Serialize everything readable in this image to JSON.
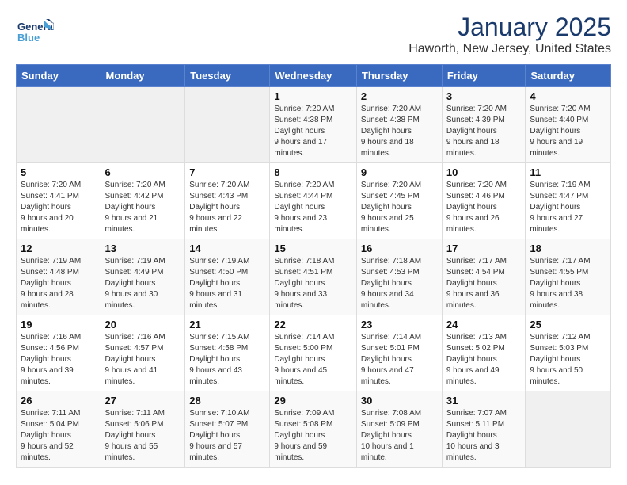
{
  "header": {
    "logo_line1": "General",
    "logo_line2": "Blue",
    "month": "January 2025",
    "location": "Haworth, New Jersey, United States"
  },
  "days_of_week": [
    "Sunday",
    "Monday",
    "Tuesday",
    "Wednesday",
    "Thursday",
    "Friday",
    "Saturday"
  ],
  "weeks": [
    [
      {
        "day": "",
        "empty": true
      },
      {
        "day": "",
        "empty": true
      },
      {
        "day": "",
        "empty": true
      },
      {
        "day": "1",
        "sunrise": "7:20 AM",
        "sunset": "4:38 PM",
        "daylight": "9 hours and 17 minutes."
      },
      {
        "day": "2",
        "sunrise": "7:20 AM",
        "sunset": "4:38 PM",
        "daylight": "9 hours and 18 minutes."
      },
      {
        "day": "3",
        "sunrise": "7:20 AM",
        "sunset": "4:39 PM",
        "daylight": "9 hours and 18 minutes."
      },
      {
        "day": "4",
        "sunrise": "7:20 AM",
        "sunset": "4:40 PM",
        "daylight": "9 hours and 19 minutes."
      }
    ],
    [
      {
        "day": "5",
        "sunrise": "7:20 AM",
        "sunset": "4:41 PM",
        "daylight": "9 hours and 20 minutes."
      },
      {
        "day": "6",
        "sunrise": "7:20 AM",
        "sunset": "4:42 PM",
        "daylight": "9 hours and 21 minutes."
      },
      {
        "day": "7",
        "sunrise": "7:20 AM",
        "sunset": "4:43 PM",
        "daylight": "9 hours and 22 minutes."
      },
      {
        "day": "8",
        "sunrise": "7:20 AM",
        "sunset": "4:44 PM",
        "daylight": "9 hours and 23 minutes."
      },
      {
        "day": "9",
        "sunrise": "7:20 AM",
        "sunset": "4:45 PM",
        "daylight": "9 hours and 25 minutes."
      },
      {
        "day": "10",
        "sunrise": "7:20 AM",
        "sunset": "4:46 PM",
        "daylight": "9 hours and 26 minutes."
      },
      {
        "day": "11",
        "sunrise": "7:19 AM",
        "sunset": "4:47 PM",
        "daylight": "9 hours and 27 minutes."
      }
    ],
    [
      {
        "day": "12",
        "sunrise": "7:19 AM",
        "sunset": "4:48 PM",
        "daylight": "9 hours and 28 minutes."
      },
      {
        "day": "13",
        "sunrise": "7:19 AM",
        "sunset": "4:49 PM",
        "daylight": "9 hours and 30 minutes."
      },
      {
        "day": "14",
        "sunrise": "7:19 AM",
        "sunset": "4:50 PM",
        "daylight": "9 hours and 31 minutes."
      },
      {
        "day": "15",
        "sunrise": "7:18 AM",
        "sunset": "4:51 PM",
        "daylight": "9 hours and 33 minutes."
      },
      {
        "day": "16",
        "sunrise": "7:18 AM",
        "sunset": "4:53 PM",
        "daylight": "9 hours and 34 minutes."
      },
      {
        "day": "17",
        "sunrise": "7:17 AM",
        "sunset": "4:54 PM",
        "daylight": "9 hours and 36 minutes."
      },
      {
        "day": "18",
        "sunrise": "7:17 AM",
        "sunset": "4:55 PM",
        "daylight": "9 hours and 38 minutes."
      }
    ],
    [
      {
        "day": "19",
        "sunrise": "7:16 AM",
        "sunset": "4:56 PM",
        "daylight": "9 hours and 39 minutes."
      },
      {
        "day": "20",
        "sunrise": "7:16 AM",
        "sunset": "4:57 PM",
        "daylight": "9 hours and 41 minutes."
      },
      {
        "day": "21",
        "sunrise": "7:15 AM",
        "sunset": "4:58 PM",
        "daylight": "9 hours and 43 minutes."
      },
      {
        "day": "22",
        "sunrise": "7:14 AM",
        "sunset": "5:00 PM",
        "daylight": "9 hours and 45 minutes."
      },
      {
        "day": "23",
        "sunrise": "7:14 AM",
        "sunset": "5:01 PM",
        "daylight": "9 hours and 47 minutes."
      },
      {
        "day": "24",
        "sunrise": "7:13 AM",
        "sunset": "5:02 PM",
        "daylight": "9 hours and 49 minutes."
      },
      {
        "day": "25",
        "sunrise": "7:12 AM",
        "sunset": "5:03 PM",
        "daylight": "9 hours and 50 minutes."
      }
    ],
    [
      {
        "day": "26",
        "sunrise": "7:11 AM",
        "sunset": "5:04 PM",
        "daylight": "9 hours and 52 minutes."
      },
      {
        "day": "27",
        "sunrise": "7:11 AM",
        "sunset": "5:06 PM",
        "daylight": "9 hours and 55 minutes."
      },
      {
        "day": "28",
        "sunrise": "7:10 AM",
        "sunset": "5:07 PM",
        "daylight": "9 hours and 57 minutes."
      },
      {
        "day": "29",
        "sunrise": "7:09 AM",
        "sunset": "5:08 PM",
        "daylight": "9 hours and 59 minutes."
      },
      {
        "day": "30",
        "sunrise": "7:08 AM",
        "sunset": "5:09 PM",
        "daylight": "10 hours and 1 minute."
      },
      {
        "day": "31",
        "sunrise": "7:07 AM",
        "sunset": "5:11 PM",
        "daylight": "10 hours and 3 minutes."
      },
      {
        "day": "",
        "empty": true
      }
    ]
  ]
}
